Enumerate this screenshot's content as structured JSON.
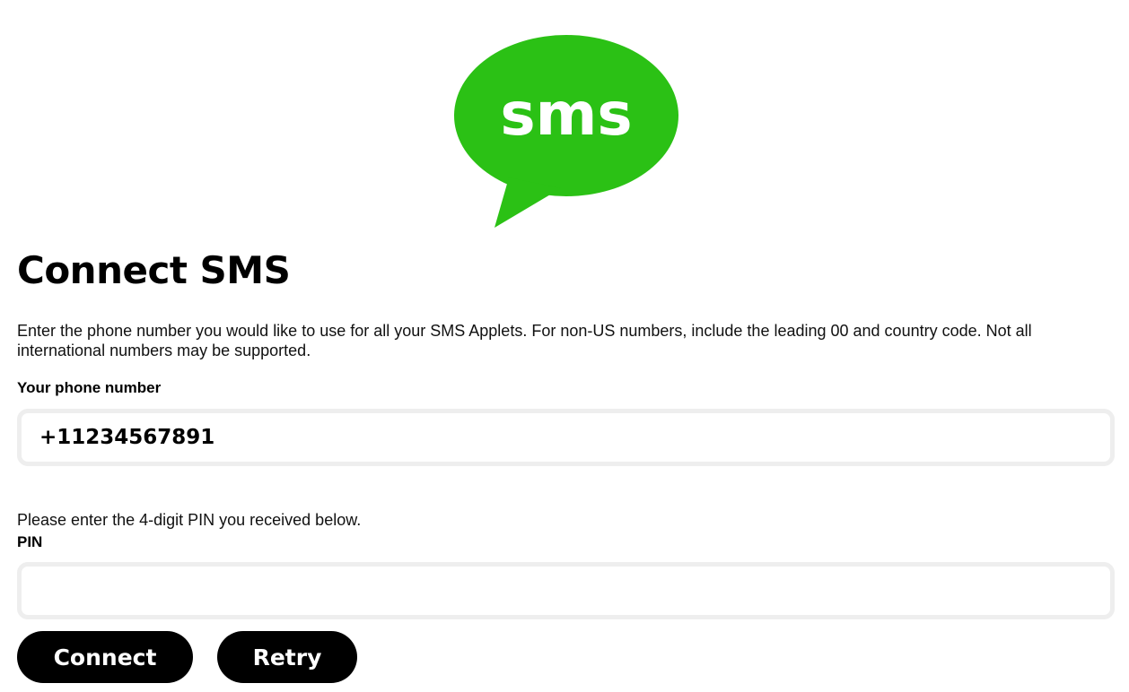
{
  "logo": {
    "text": "sms",
    "color": "#2bc115",
    "icon": "sms-speech-bubble-icon"
  },
  "page": {
    "title": "Connect SMS",
    "description": "Enter the phone number you would like to use for all your SMS Applets. For non-US numbers, include the leading 00 and country code. Not all international numbers may be supported."
  },
  "phone": {
    "label": "Your phone number",
    "value": "+11234567891"
  },
  "pin": {
    "hint": "Please enter the 4-digit PIN you received below.",
    "label": "PIN",
    "value": ""
  },
  "buttons": {
    "connect": "Connect",
    "retry": "Retry"
  }
}
